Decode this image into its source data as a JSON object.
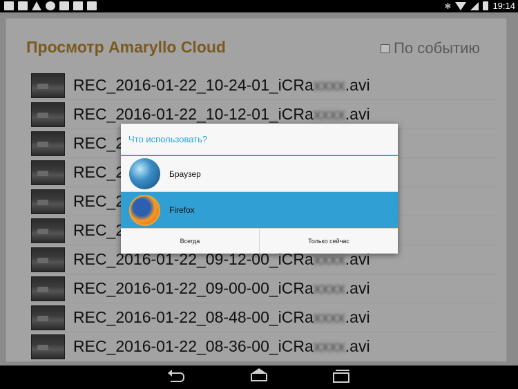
{
  "status_bar": {
    "time": "19:14",
    "bluetooth_glyph": "✱",
    "left_icons": [
      "image-icon",
      "gmail-icon",
      "warning-icon",
      "upload-icon",
      "signal-off-icon",
      "signal-off-icon",
      "signal-off-icon"
    ],
    "right_icons": [
      "bluetooth-icon",
      "wifi-icon",
      "cellular-icon",
      "battery-icon"
    ]
  },
  "app": {
    "title": "Просмотр Amaryllo Cloud",
    "event_toggle_label": "По событию",
    "files": [
      {
        "prefix": "REC_2016-01-22_10-24-01_iCRa",
        "hidden": "xxxx",
        "ext": ".avi"
      },
      {
        "prefix": "REC_2016-01-22_10-12-01_iCRa",
        "hidden": "xxxx",
        "ext": ".avi"
      },
      {
        "prefix": "REC_2",
        "hidden": "",
        "ext": ""
      },
      {
        "prefix": "REC_2",
        "hidden": "",
        "ext": ""
      },
      {
        "prefix": "REC_2",
        "hidden": "",
        "ext": ""
      },
      {
        "prefix": "REC_2",
        "hidden": "",
        "ext": ""
      },
      {
        "prefix": "REC_2016-01-22_09-12-00_iCRa",
        "hidden": "xxxx",
        "ext": ".avi"
      },
      {
        "prefix": "REC_2016-01-22_09-00-00_iCRa",
        "hidden": "xxxx",
        "ext": ".avi"
      },
      {
        "prefix": "REC_2016-01-22_08-48-00_iCRa",
        "hidden": "xxxx",
        "ext": ".avi"
      },
      {
        "prefix": "REC_2016-01-22_08-36-00_iCRa",
        "hidden": "xxxx",
        "ext": ".avi"
      }
    ]
  },
  "dialog": {
    "title": "Что использовать?",
    "options": [
      {
        "label": "Браузер",
        "icon": "browser-icon",
        "selected": false
      },
      {
        "label": "Firefox",
        "icon": "firefox-icon",
        "selected": true
      }
    ],
    "always_label": "Всегда",
    "just_once_label": "Только сейчас"
  },
  "colors": {
    "accent": "#2aa6d7",
    "selected": "#2f9fd4",
    "title": "#d38a1e"
  }
}
